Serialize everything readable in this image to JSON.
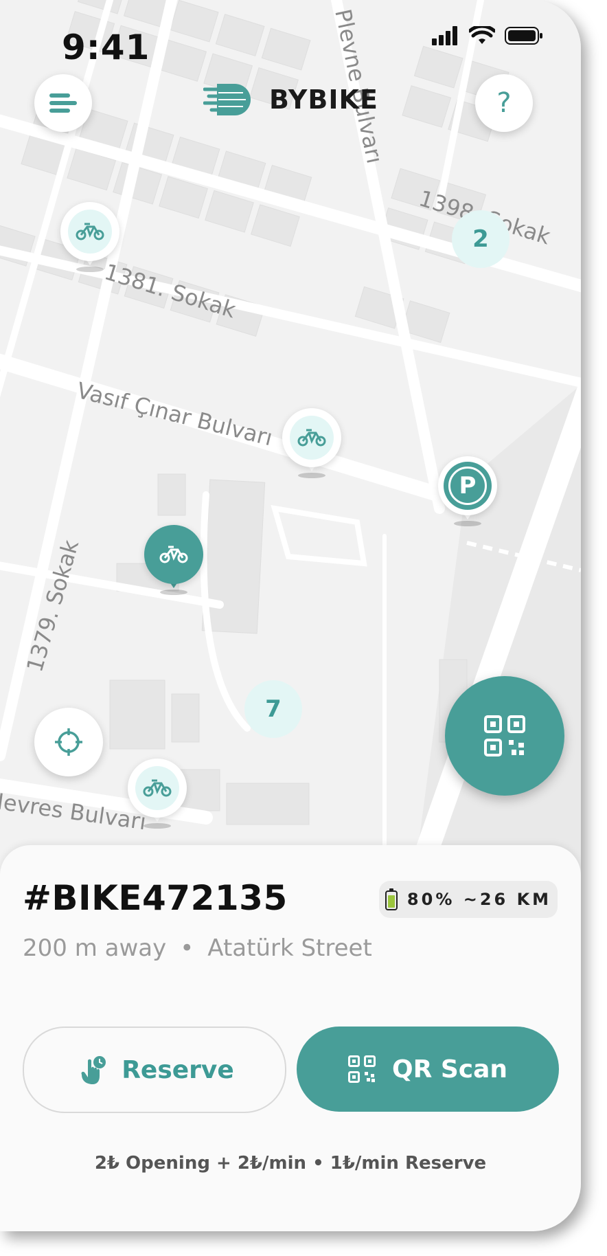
{
  "status_bar": {
    "time": "9:41"
  },
  "header": {
    "brand": "BYBIKE",
    "menu_icon": "menu-icon",
    "help_icon": "help-icon",
    "help_label": "?"
  },
  "map": {
    "street_labels": [
      "Plevne Bulvarı",
      "1398. Sokak",
      "1381. Sokak",
      "Vasıf Çınar Bulvarı",
      "1379. Sokak",
      "Nevres Bulvarı"
    ],
    "clusters": [
      "2",
      "7"
    ],
    "parking_label": "P"
  },
  "bike": {
    "id": "#BIKE472135",
    "battery": "80% ~26 KM",
    "distance": "200 m away",
    "separator": "•",
    "street": "Atatürk Street"
  },
  "actions": {
    "reserve_label": "Reserve",
    "qr_label": "QR Scan"
  },
  "pricing": "2₺ Opening + 2₺/min  •  1₺/min Reserve",
  "colors": {
    "accent": "#489e98",
    "accent_light": "#e3f6f5"
  }
}
